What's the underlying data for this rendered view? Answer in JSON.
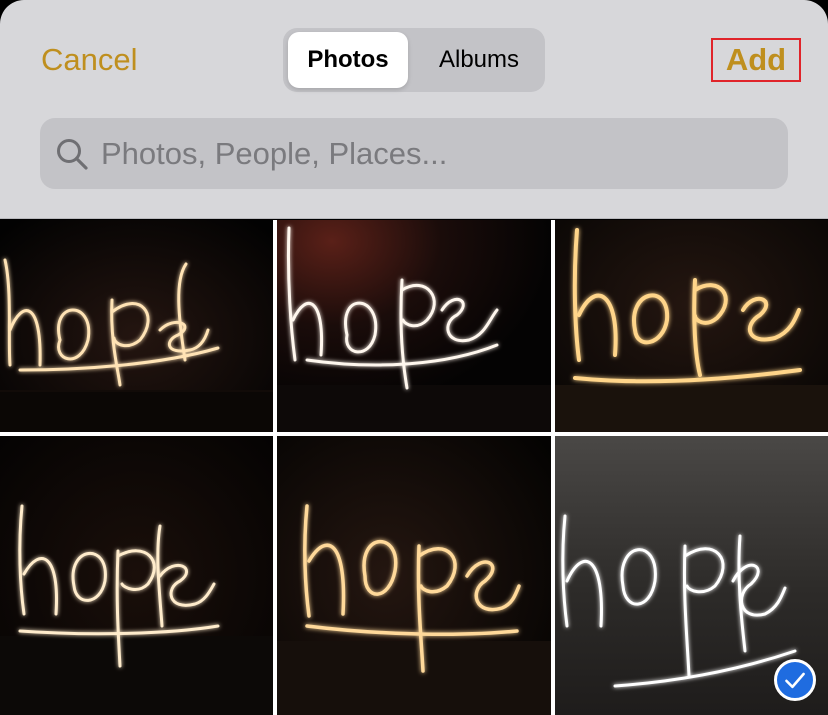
{
  "header": {
    "cancel_label": "Cancel",
    "segments": [
      {
        "label": "Photos",
        "selected": true
      },
      {
        "label": "Albums",
        "selected": false
      }
    ],
    "add_label": "Add",
    "accent_color": "#bf8f1e"
  },
  "search": {
    "placeholder": "Photos, People, Places...",
    "icon": "search-icon"
  },
  "photos": [
    {
      "text": "hope",
      "selected": false
    },
    {
      "text": "hope",
      "selected": false
    },
    {
      "text": "hope",
      "selected": false
    },
    {
      "text": "hope",
      "selected": false
    },
    {
      "text": "hope",
      "selected": false
    },
    {
      "text": "hope",
      "selected": true
    }
  ],
  "selection_icon": "checkmark-icon"
}
